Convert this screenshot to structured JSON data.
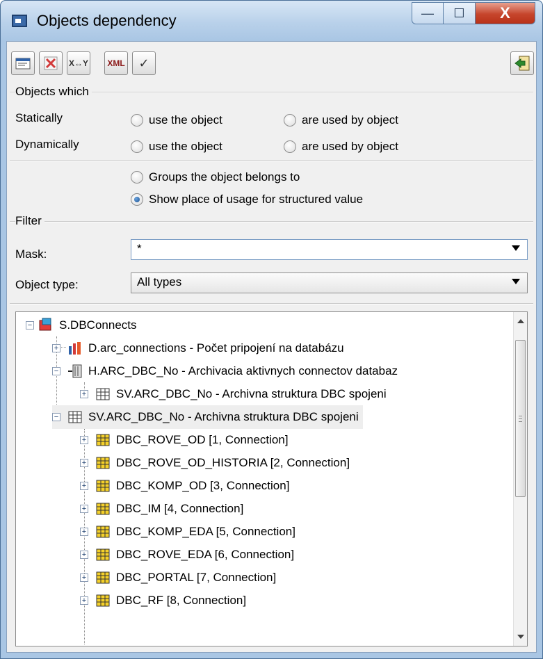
{
  "window": {
    "title": "Objects dependency",
    "controls": {
      "minimize": "—",
      "maximize": "☐",
      "close": "X"
    }
  },
  "toolbar": {
    "buttons": [
      {
        "name": "properties",
        "icon": "properties-icon"
      },
      {
        "name": "delete",
        "icon": "delete-icon"
      },
      {
        "name": "swap",
        "icon": "swap-icon",
        "text": "X↔Y"
      },
      {
        "name": "export-xml",
        "icon": "xml-icon",
        "text": "XML"
      },
      {
        "name": "apply",
        "icon": "checkmark-icon",
        "text": "✓"
      }
    ],
    "exit": {
      "icon": "exit-icon"
    }
  },
  "objects_which": {
    "heading": "Objects which",
    "statically_label": "Statically",
    "dynamically_label": "Dynamically",
    "use_the_object": "use the object",
    "are_used_by_object": "are used by object",
    "groups_label": "Groups the object belongs to",
    "show_place_label": "Show place of usage for structured value",
    "selected": "show_place"
  },
  "filter": {
    "heading": "Filter",
    "mask_label": "Mask:",
    "mask_value": "*",
    "object_type_label": "Object type:",
    "object_type_value": "All types"
  },
  "tree": {
    "items": [
      {
        "level": 0,
        "icon": "dbconnect-icon",
        "label": "S.DBConnects",
        "expanded": true
      },
      {
        "level": 1,
        "icon": "dbconnect-chart-icon",
        "label": "D.arc_connections - Počet pripojení na databázu",
        "expanded": false
      },
      {
        "level": 1,
        "icon": "archive-icon",
        "label": "H.ARC_DBC_No - Archivacia aktivnych connectov databaz",
        "expanded": true
      },
      {
        "level": 2,
        "icon": "structure-grid-icon",
        "label": "SV.ARC_DBC_No - Archivna struktura DBC spojeni",
        "expanded": false
      },
      {
        "level": 1,
        "icon": "structure-grid-icon",
        "label": "SV.ARC_DBC_No - Archivna struktura DBC spojeni",
        "expanded": true,
        "selected": true
      },
      {
        "level": 2,
        "icon": "structure-item-icon",
        "label": "DBC_ROVE_OD [1, Connection]",
        "expanded": false
      },
      {
        "level": 2,
        "icon": "structure-item-icon",
        "label": "DBC_ROVE_OD_HISTORIA [2, Connection]",
        "expanded": false
      },
      {
        "level": 2,
        "icon": "structure-item-icon",
        "label": "DBC_KOMP_OD [3, Connection]",
        "expanded": false
      },
      {
        "level": 2,
        "icon": "structure-item-icon",
        "label": "DBC_IM [4, Connection]",
        "expanded": false
      },
      {
        "level": 2,
        "icon": "structure-item-icon",
        "label": "DBC_KOMP_EDA [5, Connection]",
        "expanded": false
      },
      {
        "level": 2,
        "icon": "structure-item-icon",
        "label": "DBC_ROVE_EDA [6, Connection]",
        "expanded": false
      },
      {
        "level": 2,
        "icon": "structure-item-icon",
        "label": "DBC_PORTAL [7, Connection]",
        "expanded": false
      },
      {
        "level": 2,
        "icon": "structure-item-icon",
        "label": "DBC_RF [8, Connection]",
        "expanded": false
      }
    ],
    "scroll_position": 0.0
  }
}
